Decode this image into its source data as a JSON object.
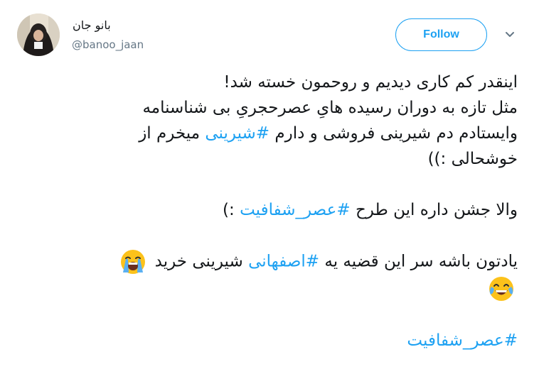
{
  "author": {
    "display_name": "بانو جان",
    "handle": "@banoo_jaan"
  },
  "follow_button": {
    "label": "Follow"
  },
  "caret": {
    "icon": "chevron-down-icon"
  },
  "tweet": {
    "p1_l1": "اینقدر کم کاری دیدیم و روحمون خسته شد!",
    "p1_l2": "مثل تازه به دوران رسیده هایِ عصرحجریِ بی شناسنامه",
    "p1_l3_pre": "وایستادم دم شیرینی فروشی و دارم ",
    "p1_l3_tag": "#شیرینی",
    "p1_l3_post": " میخرم از",
    "p1_l4": "خوشحالی :))",
    "p2_pre": "والا جشن داره این طرح ",
    "p2_tag": "#عصر_شفافیت",
    "p2_post": " :)",
    "p3_pre": "یادتون باشه سر این قضیه یه ",
    "p3_tag": "#اصفهانی",
    "p3_post": " شیرینی خرید ",
    "emoji_1": "loudly-crying-face-icon",
    "emoji_2": "face-with-tears-of-joy-icon",
    "p4_tag": "#عصر_شفافیت"
  },
  "colors": {
    "accent": "#1da1f2",
    "text": "#14171a",
    "muted": "#657786"
  }
}
